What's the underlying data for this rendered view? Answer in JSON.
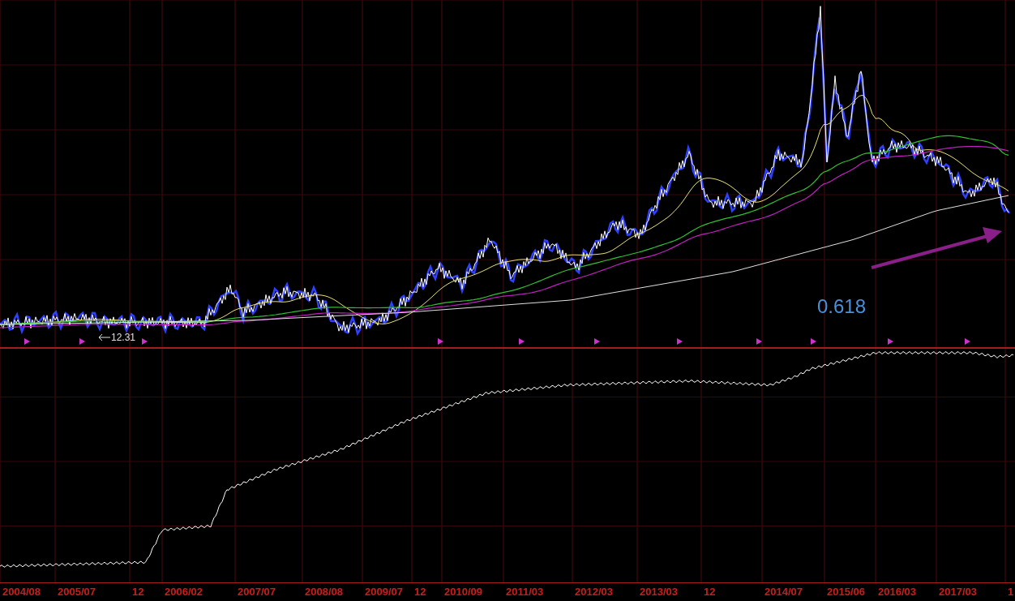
{
  "price_panel": {
    "low_label": "12.31",
    "ratio_label": "0.618"
  },
  "time_axis": {
    "labels": [
      "2004/08",
      "2005/07",
      "12",
      "2006/02",
      "2007/07",
      "2008/08",
      "2009/07",
      "12",
      "2010/09",
      "2011/03",
      "2012/03",
      "2013/03",
      "12",
      "2014/07",
      "2015/06",
      "2016/03",
      "2017/03",
      "1"
    ]
  }
}
